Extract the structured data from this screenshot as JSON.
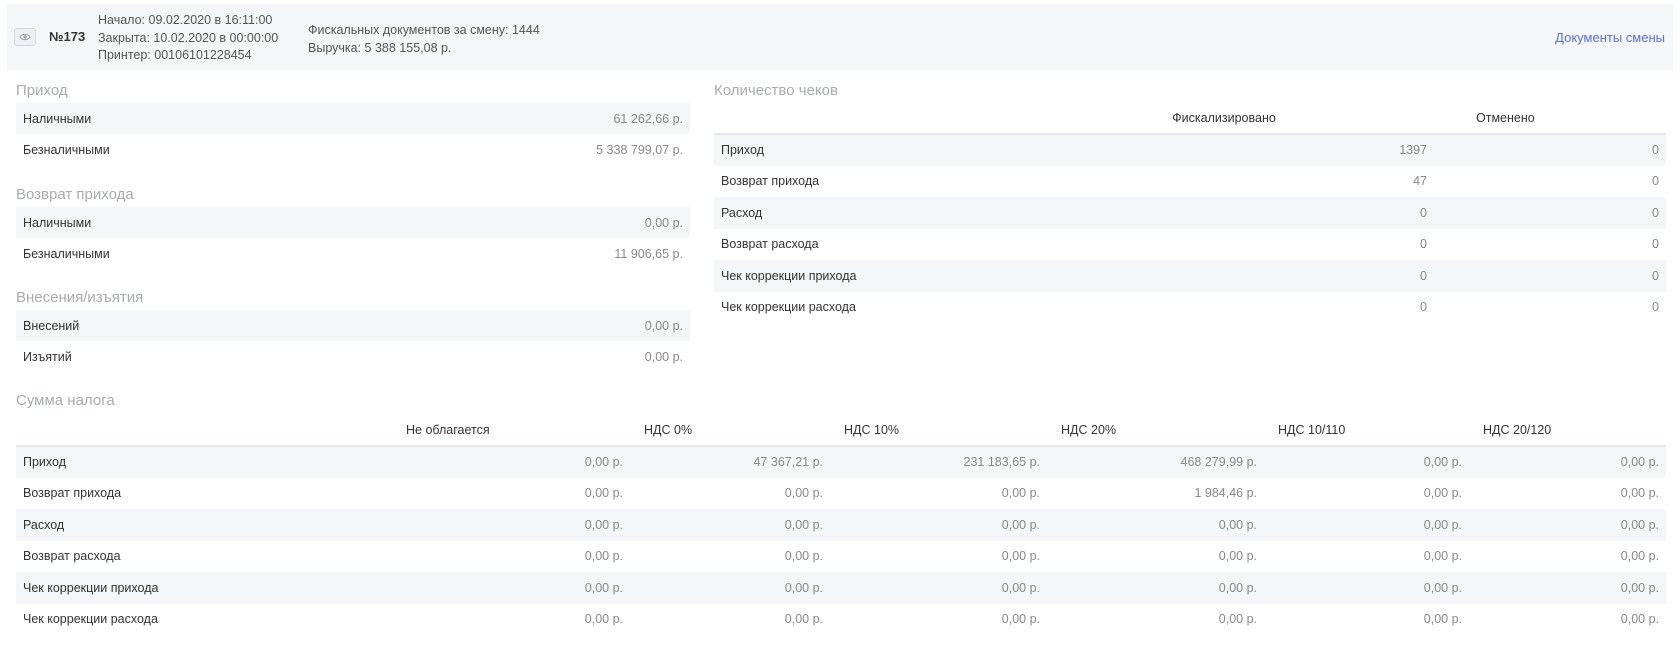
{
  "header": {
    "shift_number": "№173",
    "start": "Начало: 09.02.2020 в 16:11:00",
    "closed": "Закрыта: 10.02.2020 в 00:00:00",
    "printer": "Принтер: 00106101228454",
    "fiscal_docs": "Фискальных документов за смену: 1444",
    "revenue": "Выручка: 5 388 155,08 р.",
    "docs_link": "Документы смены",
    "eye_icon": "eye-icon"
  },
  "income": {
    "title": "Приход",
    "rows": [
      {
        "label": "Наличными",
        "value": "61 262,66 р."
      },
      {
        "label": "Безналичными",
        "value": "5 338 799,07 р."
      }
    ]
  },
  "income_return": {
    "title": "Возврат прихода",
    "rows": [
      {
        "label": "Наличными",
        "value": "0,00 р."
      },
      {
        "label": "Безналичными",
        "value": "11 906,65 р."
      }
    ]
  },
  "deposits": {
    "title": "Внесения/изъятия",
    "rows": [
      {
        "label": "Внесений",
        "value": "0,00 р."
      },
      {
        "label": "Изъятий",
        "value": "0,00 р."
      }
    ]
  },
  "receipts": {
    "title": "Количество чеков",
    "columns": [
      "Фискализировано",
      "Отменено"
    ],
    "rows": [
      {
        "label": "Приход",
        "fiscal": "1397",
        "cancelled": "0"
      },
      {
        "label": "Возврат прихода",
        "fiscal": "47",
        "cancelled": "0"
      },
      {
        "label": "Расход",
        "fiscal": "0",
        "cancelled": "0"
      },
      {
        "label": "Возврат расхода",
        "fiscal": "0",
        "cancelled": "0"
      },
      {
        "label": "Чек коррекции прихода",
        "fiscal": "0",
        "cancelled": "0"
      },
      {
        "label": "Чек коррекции расхода",
        "fiscal": "0",
        "cancelled": "0"
      }
    ]
  },
  "tax": {
    "title": "Сумма налога",
    "columns": [
      "Не облагается",
      "НДС 0%",
      "НДС 10%",
      "НДС 20%",
      "НДС 10/110",
      "НДС 20/120"
    ],
    "rows": [
      {
        "label": "Приход",
        "values": [
          "0,00 р.",
          "47 367,21 р.",
          "231 183,65 р.",
          "468 279,99 р.",
          "0,00 р.",
          "0,00 р."
        ]
      },
      {
        "label": "Возврат прихода",
        "values": [
          "0,00 р.",
          "0,00 р.",
          "0,00 р.",
          "1 984,46 р.",
          "0,00 р.",
          "0,00 р."
        ]
      },
      {
        "label": "Расход",
        "values": [
          "0,00 р.",
          "0,00 р.",
          "0,00 р.",
          "0,00 р.",
          "0,00 р.",
          "0,00 р."
        ]
      },
      {
        "label": "Возврат расхода",
        "values": [
          "0,00 р.",
          "0,00 р.",
          "0,00 р.",
          "0,00 р.",
          "0,00 р.",
          "0,00 р."
        ]
      },
      {
        "label": "Чек коррекции прихода",
        "values": [
          "0,00 р.",
          "0,00 р.",
          "0,00 р.",
          "0,00 р.",
          "0,00 р.",
          "0,00 р."
        ]
      },
      {
        "label": "Чек коррекции расхода",
        "values": [
          "0,00 р.",
          "0,00 р.",
          "0,00 р.",
          "0,00 р.",
          "0,00 р.",
          "0,00 р."
        ]
      }
    ]
  }
}
